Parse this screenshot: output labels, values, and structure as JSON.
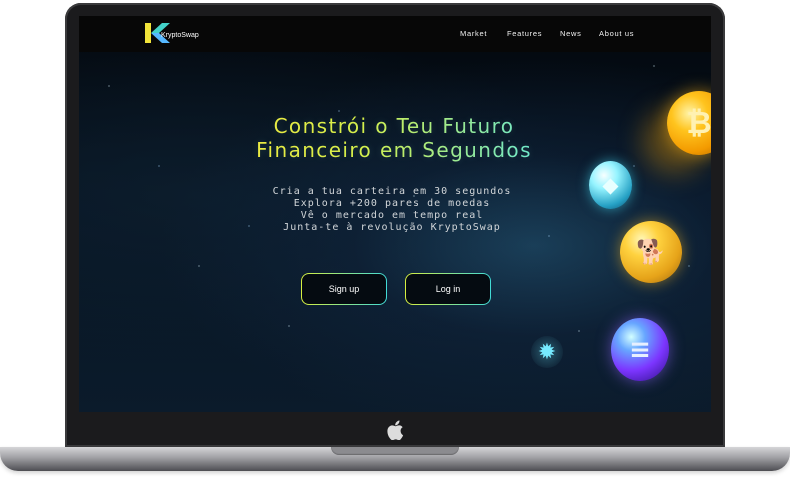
{
  "app": {
    "brand_name": "KryptoSwap",
    "logo_icon": "k-logo-icon",
    "bezel_icon": "apple-icon"
  },
  "navigation": {
    "items": [
      "Market",
      "Features",
      "News",
      "About us"
    ]
  },
  "hero": {
    "title_lines": [
      "Constrói o Teu Futuro",
      "Financeiro em Segundos"
    ],
    "subtitle_lines": [
      "Cria a tua carteira em 30 segundos",
      "Explora +200 pares de moedas",
      "Vê o mercado em tempo real",
      "Junta-te à revolução KryptoSwap"
    ],
    "primary_button": "Sign up",
    "secondary_button": "Log in"
  },
  "coins": [
    {
      "name": "bitcoin-icon",
      "symbol": "₿"
    },
    {
      "name": "ethereum-icon",
      "symbol": "◆"
    },
    {
      "name": "dogecoin-icon",
      "symbol": "🐕"
    },
    {
      "name": "solana-icon",
      "symbol": "≡"
    },
    {
      "name": "cardano-icon",
      "symbol": "✹"
    }
  ],
  "colors": {
    "title_yellow": "#f5ea3b",
    "title_cyan": "#5de6df",
    "button_border_yellow": "#d7ef3f",
    "button_border_cyan": "#41dbd7",
    "background_dark": "#03070c"
  }
}
